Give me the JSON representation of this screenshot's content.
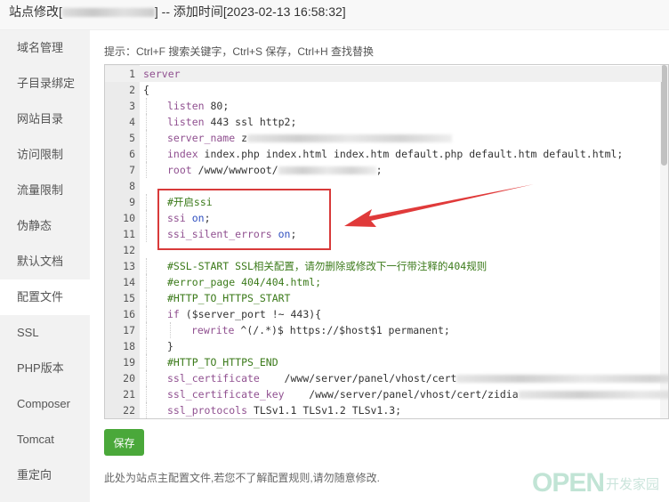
{
  "title": {
    "prefix": "站点修改[",
    "suffix": "] -- 添加时间[2023-02-13 16:58:32]"
  },
  "sidebar": {
    "items": [
      {
        "label": "域名管理"
      },
      {
        "label": "子目录绑定"
      },
      {
        "label": "网站目录"
      },
      {
        "label": "访问限制"
      },
      {
        "label": "流量限制"
      },
      {
        "label": "伪静态"
      },
      {
        "label": "默认文档"
      },
      {
        "label": "配置文件",
        "active": true
      },
      {
        "label": "SSL"
      },
      {
        "label": "PHP版本"
      },
      {
        "label": "Composer"
      },
      {
        "label": "Tomcat"
      },
      {
        "label": "重定向"
      }
    ]
  },
  "hint": "提示：Ctrl+F 搜索关键字，Ctrl+S 保存，Ctrl+H 查找替换",
  "editor": {
    "lines": [
      {
        "n": "1",
        "indent": 0,
        "segs": [
          [
            "k",
            "server"
          ]
        ]
      },
      {
        "n": "2",
        "indent": 0,
        "segs": [
          [
            "p",
            "{"
          ]
        ]
      },
      {
        "n": "3",
        "indent": 1,
        "segs": [
          [
            "k",
            "listen"
          ],
          [
            "p",
            " 80;"
          ]
        ]
      },
      {
        "n": "4",
        "indent": 1,
        "segs": [
          [
            "k",
            "listen"
          ],
          [
            "p",
            " 443 ssl http2;"
          ]
        ]
      },
      {
        "n": "5",
        "indent": 1,
        "segs": [
          [
            "k",
            "server_name"
          ],
          [
            "p",
            " z"
          ],
          [
            "blur",
            ""
          ]
        ]
      },
      {
        "n": "6",
        "indent": 1,
        "segs": [
          [
            "k",
            "index"
          ],
          [
            "p",
            " index.php index.html index.htm default.php default.htm default.html;"
          ]
        ]
      },
      {
        "n": "7",
        "indent": 1,
        "segs": [
          [
            "k",
            "root"
          ],
          [
            "p",
            " /www/wwwroot/"
          ],
          [
            "blur",
            ""
          ],
          [
            "p",
            ";"
          ]
        ]
      },
      {
        "n": "8",
        "indent": 0,
        "segs": []
      },
      {
        "n": "9",
        "indent": 1,
        "segs": [
          [
            "c",
            "#开启ssi"
          ]
        ]
      },
      {
        "n": "10",
        "indent": 1,
        "segs": [
          [
            "k",
            "ssi"
          ],
          [
            "v",
            " on"
          ],
          [
            "p",
            ";"
          ]
        ]
      },
      {
        "n": "11",
        "indent": 1,
        "segs": [
          [
            "k",
            "ssi_silent_errors"
          ],
          [
            "v",
            " on"
          ],
          [
            "p",
            ";"
          ]
        ]
      },
      {
        "n": "12",
        "indent": 0,
        "segs": []
      },
      {
        "n": "13",
        "indent": 1,
        "segs": [
          [
            "c",
            "#SSL-START SSL相关配置，请勿删除或修改下一行带注释的404规则"
          ]
        ]
      },
      {
        "n": "14",
        "indent": 1,
        "segs": [
          [
            "c",
            "#error_page 404/404.html;"
          ]
        ]
      },
      {
        "n": "15",
        "indent": 1,
        "segs": [
          [
            "c",
            "#HTTP_TO_HTTPS_START"
          ]
        ]
      },
      {
        "n": "16",
        "indent": 1,
        "segs": [
          [
            "k",
            "if"
          ],
          [
            "p",
            " ($server_port !~ 443){"
          ]
        ]
      },
      {
        "n": "17",
        "indent": 2,
        "segs": [
          [
            "k",
            "rewrite"
          ],
          [
            "p",
            " ^(/.*)$ https://$host$1 permanent;"
          ]
        ]
      },
      {
        "n": "18",
        "indent": 1,
        "segs": [
          [
            "p",
            "}"
          ]
        ]
      },
      {
        "n": "19",
        "indent": 1,
        "segs": [
          [
            "c",
            "#HTTP_TO_HTTPS_END"
          ]
        ]
      },
      {
        "n": "20",
        "indent": 1,
        "segs": [
          [
            "k",
            "ssl_certificate"
          ],
          [
            "p",
            "    /www/server/panel/vhost/cert"
          ],
          [
            "blur",
            ""
          ]
        ]
      },
      {
        "n": "21",
        "indent": 1,
        "segs": [
          [
            "k",
            "ssl_certificate_key"
          ],
          [
            "p",
            "    /www/server/panel/vhost/cert/zidia"
          ],
          [
            "blur",
            ""
          ],
          [
            "p",
            "m;"
          ]
        ]
      },
      {
        "n": "22",
        "indent": 1,
        "segs": [
          [
            "k",
            "ssl_protocols"
          ],
          [
            "p",
            " TLSv1.1 TLSv1.2 TLSv1.3;"
          ]
        ]
      }
    ]
  },
  "save_label": "保存",
  "footer": "此处为站点主配置文件,若您不了解配置规则,请勿随意修改.",
  "watermark": {
    "logo": "OPEN",
    "text": "开发家园"
  },
  "colors": {
    "accent": "#4aa83a",
    "highlight": "#d83a3a"
  }
}
